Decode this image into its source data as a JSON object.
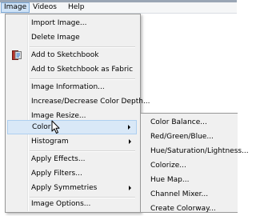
{
  "menubar": {
    "items": [
      {
        "label": "Image",
        "active": true
      },
      {
        "label": "Videos",
        "active": false
      },
      {
        "label": "Help",
        "active": false
      }
    ]
  },
  "image_menu": {
    "items": [
      {
        "label": "Import Image..."
      },
      {
        "label": "Delete Image"
      },
      {
        "label": "Add to Sketchbook",
        "icon": "sketchbook-icon"
      },
      {
        "label": "Add to Sketchbook as Fabric"
      },
      {
        "label": "Image Information..."
      },
      {
        "label": "Increase/Decrease Color Depth..."
      },
      {
        "label": "Image Resize..."
      },
      {
        "label": "Color",
        "submenu": true,
        "highlighted": true
      },
      {
        "label": "Histogram",
        "submenu": true
      },
      {
        "label": "Apply Effects..."
      },
      {
        "label": "Apply Filters..."
      },
      {
        "label": "Apply Symmetries",
        "submenu": true
      },
      {
        "label": "Image Options..."
      }
    ]
  },
  "color_submenu": {
    "items": [
      {
        "label": "Color Balance..."
      },
      {
        "label": "Red/Green/Blue..."
      },
      {
        "label": "Hue/Saturation/Lightness..."
      },
      {
        "label": "Colorize..."
      },
      {
        "label": "Hue Map..."
      },
      {
        "label": "Channel Mixer..."
      },
      {
        "label": "Create Colorway..."
      }
    ]
  },
  "colors": {
    "highlight": "#d9e8f7",
    "menu_bg": "#f0f0f0",
    "active_menubar": "#cfe3f7"
  }
}
